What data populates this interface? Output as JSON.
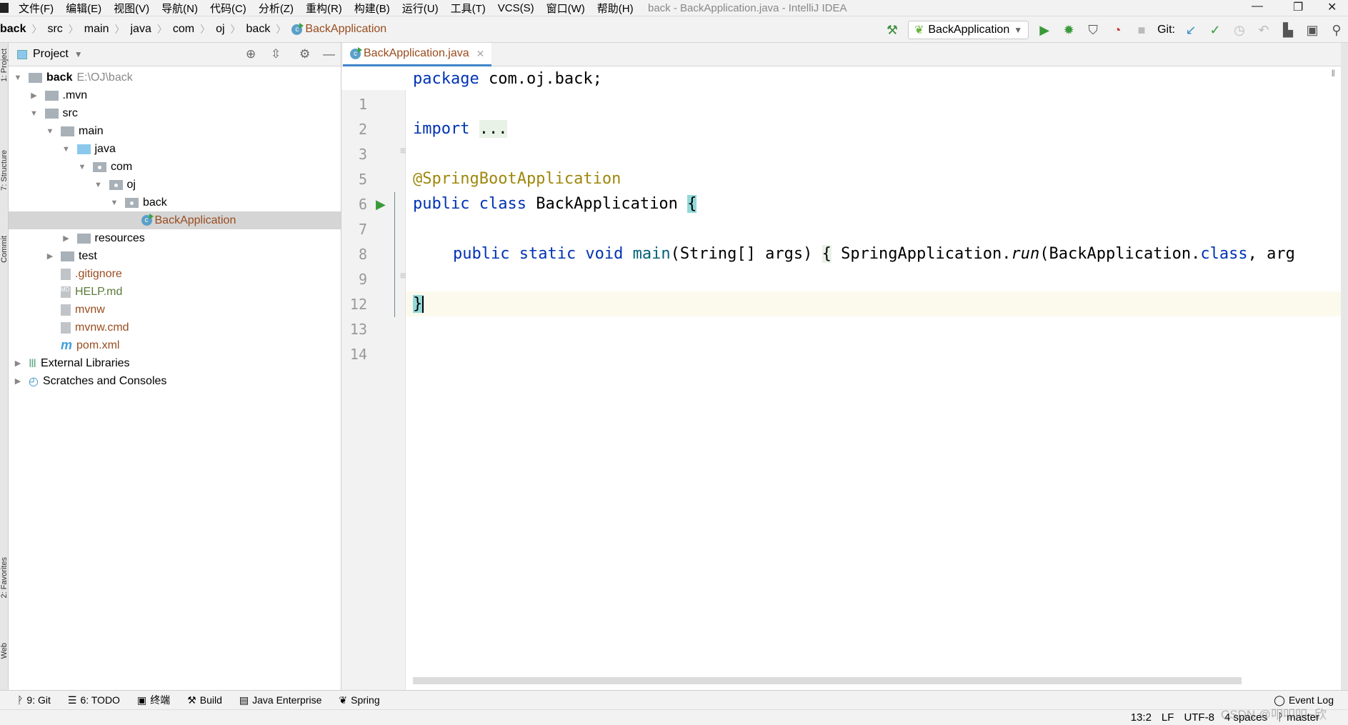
{
  "menu": [
    "文件(F)",
    "编辑(E)",
    "视图(V)",
    "导航(N)",
    "代码(C)",
    "分析(Z)",
    "重构(R)",
    "构建(B)",
    "运行(U)",
    "工具(T)",
    "VCS(S)",
    "窗口(W)",
    "帮助(H)"
  ],
  "window_title": "back - BackApplication.java - IntelliJ IDEA",
  "breadcrumb": [
    "back",
    "src",
    "main",
    "java",
    "com",
    "oj",
    "back",
    "BackApplication"
  ],
  "toolbar": {
    "run_config": "BackApplication",
    "git_label": "Git:"
  },
  "left_stripe": [
    "1: Project",
    "7: Structure",
    "Commit",
    "2: Favorites",
    "Web"
  ],
  "project": {
    "title": "Project",
    "tree": [
      {
        "label": "back",
        "extra": "E:\\OJ\\back",
        "depth": 0,
        "arrow": "down",
        "icon": "module"
      },
      {
        "label": ".mvn",
        "depth": 1,
        "arrow": "right",
        "icon": "folder"
      },
      {
        "label": "src",
        "depth": 1,
        "arrow": "down",
        "icon": "folder"
      },
      {
        "label": "main",
        "depth": 2,
        "arrow": "down",
        "icon": "folder"
      },
      {
        "label": "java",
        "depth": 3,
        "arrow": "down",
        "icon": "src"
      },
      {
        "label": "com",
        "depth": 4,
        "arrow": "down",
        "icon": "pkg"
      },
      {
        "label": "oj",
        "depth": 5,
        "arrow": "down",
        "icon": "pkg"
      },
      {
        "label": "back",
        "depth": 6,
        "arrow": "down",
        "icon": "pkg"
      },
      {
        "label": "BackApplication",
        "depth": 7,
        "arrow": "",
        "icon": "class",
        "selected": true
      },
      {
        "label": "resources",
        "depth": 3,
        "arrow": "right",
        "icon": "folder"
      },
      {
        "label": "test",
        "depth": 2,
        "arrow": "right",
        "icon": "folder"
      },
      {
        "label": ".gitignore",
        "depth": 2,
        "arrow": "",
        "icon": "file"
      },
      {
        "label": "HELP.md",
        "depth": 2,
        "arrow": "",
        "icon": "md"
      },
      {
        "label": "mvnw",
        "depth": 2,
        "arrow": "",
        "icon": "file"
      },
      {
        "label": "mvnw.cmd",
        "depth": 2,
        "arrow": "",
        "icon": "file"
      },
      {
        "label": "pom.xml",
        "depth": 2,
        "arrow": "",
        "icon": "maven"
      },
      {
        "label": "External Libraries",
        "depth": 0,
        "arrow": "right",
        "icon": "lib"
      },
      {
        "label": "Scratches and Consoles",
        "depth": 0,
        "arrow": "right",
        "icon": "scratch"
      }
    ]
  },
  "editor": {
    "tab": "BackApplication.java",
    "line_numbers": [
      "1",
      "2",
      "3",
      "5",
      "6",
      "7",
      "8",
      "9",
      "12",
      "13",
      "14"
    ],
    "lines": {
      "l1a": "package",
      "l1b": " com.oj.back;",
      "l3a": "import",
      "l3b": "...",
      "l6": "@SpringBootApplication",
      "l7a": "public class",
      "l7b": " BackApplication ",
      "l7c": "{",
      "l9a": "public static void ",
      "l9b": "main",
      "l9c": "(String[] args) ",
      "l9d": "{",
      "l9e": " SpringApplication.",
      "l9f": "run",
      "l9g": "(BackApplication.",
      "l9h": "class",
      "l9i": ", arg",
      "l13": "}"
    }
  },
  "tool_windows": [
    "9: Git",
    "6: TODO",
    "终端",
    "Build",
    "Java Enterprise",
    "Spring",
    "Event Log"
  ],
  "status": {
    "position": "13:2",
    "line_sep": "LF",
    "encoding": "UTF-8",
    "indent": "4 spaces",
    "branch": "master"
  },
  "watermark": "CSDN @叩叩叩~欣"
}
